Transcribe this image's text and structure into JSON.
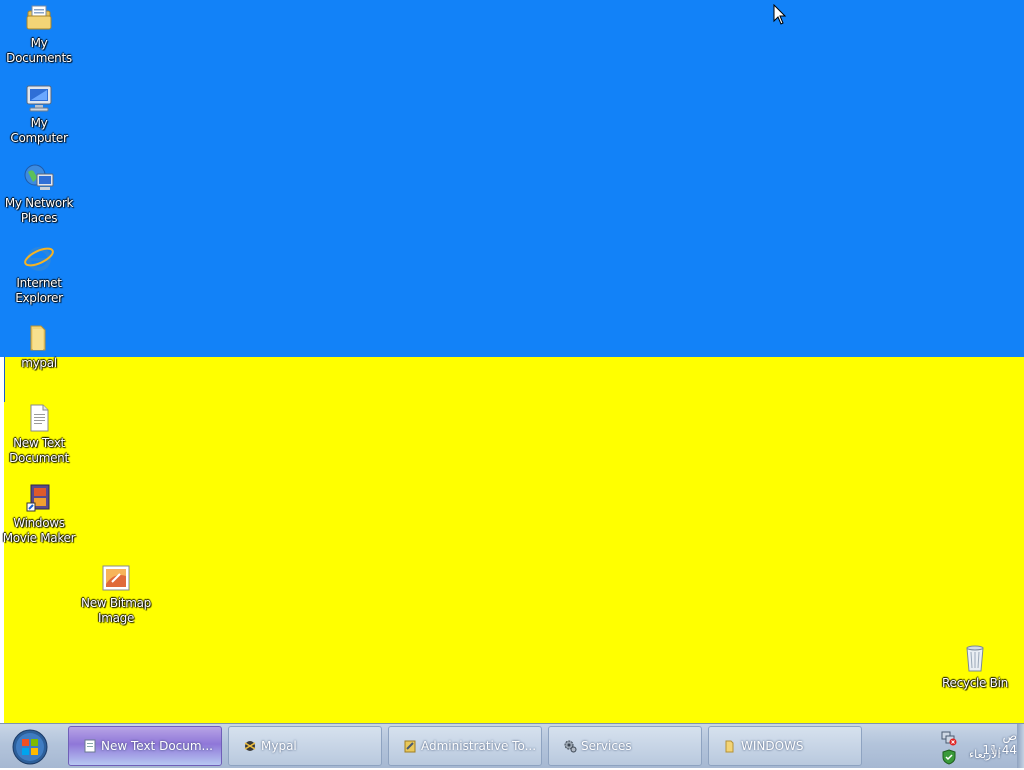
{
  "desktop": {
    "background_top_color": "#1282f8",
    "background_bottom_color": "#ffff00",
    "icons": [
      {
        "line1": "My",
        "line2": "Documents",
        "icon": "my-documents-icon"
      },
      {
        "line1": "My Computer",
        "line2": "",
        "icon": "my-computer-icon"
      },
      {
        "line1": "My Network",
        "line2": "Places",
        "icon": "network-places-icon"
      },
      {
        "line1": "Internet",
        "line2": "Explorer",
        "icon": "internet-explorer-icon"
      },
      {
        "line1": "mypal",
        "line2": "",
        "icon": "folder-icon"
      },
      {
        "line1": "New Text",
        "line2": "Document",
        "icon": "text-document-icon"
      },
      {
        "line1": "Windows",
        "line2": "Movie Maker",
        "icon": "movie-maker-icon"
      },
      {
        "line1": "New Bitmap",
        "line2": "Image",
        "icon": "bitmap-image-icon"
      },
      {
        "line1": "Recycle Bin",
        "line2": "",
        "icon": "recycle-bin-icon"
      }
    ]
  },
  "taskbar": {
    "start_icon": "windows-start-orb-icon",
    "tasks": [
      {
        "label": "New Text Docum...",
        "icon": "notepad-icon",
        "active": true
      },
      {
        "label": "Mypal",
        "icon": "mypal-browser-icon",
        "active": false
      },
      {
        "label": "Administrative To...",
        "icon": "admin-tools-icon",
        "active": false
      },
      {
        "label": "Services",
        "icon": "services-gear-icon",
        "active": false
      },
      {
        "label": "WINDOWS",
        "icon": "folder-icon",
        "active": false
      }
    ],
    "tray": {
      "time": "ص 11:44",
      "day": "الأربعاء",
      "icons": [
        "network-error-icon",
        "security-shield-icon"
      ]
    }
  }
}
